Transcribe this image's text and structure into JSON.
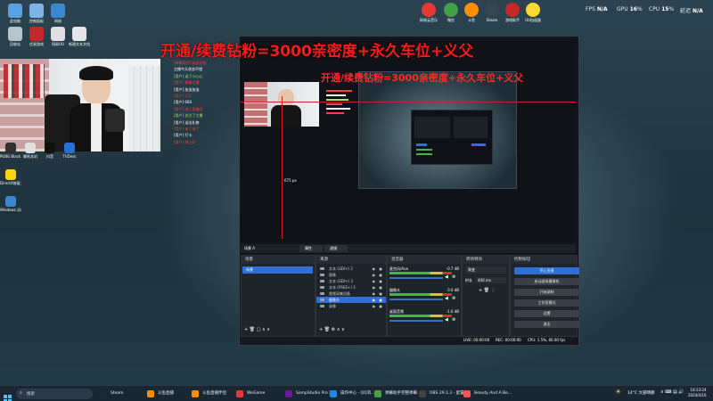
{
  "perf": {
    "fps_label": "FPS",
    "fps_value": "N/A",
    "gpu_label": "GPU",
    "gpu_value": "16",
    "cpu_label": "CPU",
    "cpu_value": "15",
    "latency_label": "延迟",
    "latency_value": "N/A"
  },
  "desktop_icons_left": [
    {
      "label": "此电脑"
    },
    {
      "label": "控制面板"
    },
    {
      "label": "网络"
    },
    {
      "label": "回收站"
    },
    {
      "label": "优易游戏"
    },
    {
      "label": "网易UU"
    },
    {
      "label": "新建文本文档"
    }
  ],
  "desktop_icons_bottom_left": [
    {
      "label": "PUBG Black Budget Pl..."
    },
    {
      "label": "聊纸本机"
    },
    {
      "label": "抖音"
    },
    {
      "label": "TVDesk"
    },
    {
      "label": "DirectX修复工具"
    },
    {
      "label": "Windows 风格之家"
    }
  ],
  "desktop_icons_top": [
    {
      "label": "网易云音乐"
    },
    {
      "label": "微信"
    },
    {
      "label": "斗鱼"
    },
    {
      "label": "Steam"
    },
    {
      "label": "游戏助手"
    },
    {
      "label": "UU加速器"
    }
  ],
  "banner": {
    "main": "开通/续费钻粉=3000亲密度+永久车位+义父",
    "inner": "开通/续费钻粉=3000亲密度+永久车位+义父"
  },
  "preview": {
    "resolution_label": "675 px"
  },
  "chat_lines": [
    {
      "text": "[弹幕助手] 欢迎光临"
    },
    {
      "text": "主播今天状态不错"
    },
    {
      "text": "[用户] 送了小心心"
    },
    {
      "text": "[用户] 谢谢主播"
    },
    {
      "text": "[用户] 加油加油"
    },
    {
      "text": "[用户] 111"
    },
    {
      "text": "[用户] 666"
    },
    {
      "text": "[用户] 进入直播间"
    },
    {
      "text": "[用户] 关注了主播"
    },
    {
      "text": "[用户] 送出礼物"
    },
    {
      "text": "[用户] 来了来了"
    },
    {
      "text": "[用户] 打卡"
    },
    {
      "text": "[用户] 晚上好"
    }
  ],
  "obs": {
    "scene_tab": "场景 A",
    "toolbar_source_label": "属性",
    "toolbar_filter_label": "滤镜",
    "scenes_header": "场景",
    "scenes": [
      "场景"
    ],
    "sources_header": "来源",
    "sources": [
      {
        "name": "文本 (GDI+) 2"
      },
      {
        "name": "图像"
      },
      {
        "name": "文本 (GDI+) 3"
      },
      {
        "name": "文本 (FREE+) 3"
      },
      {
        "name": "视频采集设备"
      },
      {
        "name": "摄像头"
      },
      {
        "name": "录像"
      }
    ],
    "mixer_header": "混音器",
    "mixer_channels": [
      {
        "name": "麦克风/Aux",
        "db": "-0.7 dB"
      },
      {
        "name": "摄像头",
        "db": "0.0 dB"
      },
      {
        "name": "桌面音频",
        "db": "-1.6 dB"
      }
    ],
    "transitions_header": "转场特效",
    "transition_type": "渐变",
    "duration_label": "时长",
    "duration_value": "400 ms",
    "controls_header": "控制按钮",
    "controls": [
      "停止直播",
      "启动虚拟摄像机",
      "开始录制",
      "工作室模式",
      "设置",
      "退出"
    ],
    "status": {
      "live": "LIVE: 00:00:00",
      "rec": "REC: 00:00:00",
      "cpu": "CPU: 1.5%, 60.00 fps"
    }
  },
  "taskbar": {
    "search": "搜索",
    "apps": [
      {
        "label": "Steam"
      },
      {
        "label": "斗鱼直播"
      },
      {
        "label": "斗鱼直播伴侣"
      },
      {
        "label": "WeGame"
      },
      {
        "label": "SampStudio Pro X..."
      },
      {
        "label": "操作中心 - QQ浏..."
      },
      {
        "label": "弹幕助手完整弹幕..."
      },
      {
        "label": "OBS 29.1.3 - 配置..."
      },
      {
        "label": "Beauty And A Be..."
      }
    ],
    "weather": "14°C 大部晴朗",
    "time": "18:13:24",
    "date": "2024/4/16"
  },
  "colors": {
    "accent": "#2f6fd6",
    "banner_red": "#ff1a1a",
    "chat_red": "#ff3b3b",
    "chat_green": "#a8e06a",
    "taskbar": "#1a2733"
  }
}
